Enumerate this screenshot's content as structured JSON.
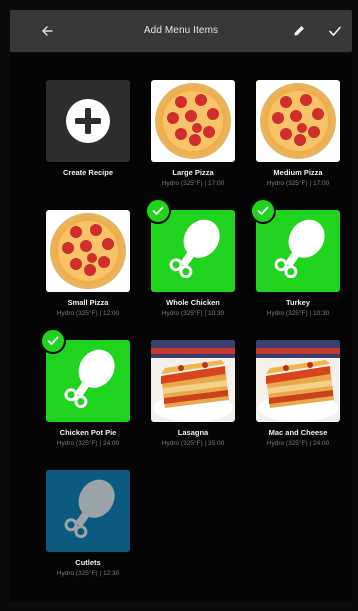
{
  "header": {
    "title": "Add Menu Items"
  },
  "icons": {
    "back": "arrow-left-icon",
    "edit": "pencil-icon",
    "confirm": "checkmark-icon",
    "add": "plus-icon",
    "selected": "check-badge-icon",
    "drumstick": "drumstick-icon"
  },
  "colors": {
    "selected_green": "#1fd31f",
    "blue_tile": "#0c5a7e",
    "topbar": "#383838",
    "background": "#0b0b0b"
  },
  "items": [
    {
      "name": "Create Recipe",
      "detail": ""
    },
    {
      "name": "Large Pizza",
      "detail": "Hydro (325°F) | 17:00",
      "image": "pizza",
      "selected": false
    },
    {
      "name": "Medium Pizza",
      "detail": "Hydro (325°F) | 17:00",
      "image": "pizza",
      "selected": false
    },
    {
      "name": "Small Pizza",
      "detail": "Hydro (325°F) | 12:00",
      "image": "pizza",
      "selected": false
    },
    {
      "name": "Whole Chicken",
      "detail": "Hydro (325°F) | 10:30",
      "image": "drumstick",
      "selected": true
    },
    {
      "name": "Turkey",
      "detail": "Hydro (325°F) | 10:30",
      "image": "drumstick",
      "selected": true
    },
    {
      "name": "Chicken Pot Pie",
      "detail": "Hydro (325°F) | 24:00",
      "image": "drumstick",
      "selected": true
    },
    {
      "name": "Lasagna",
      "detail": "Hydro (325°F) | 35:00",
      "image": "lasagna",
      "selected": false
    },
    {
      "name": "Mac and Cheese",
      "detail": "Hydro (325°F) | 24:00",
      "image": "lasagna",
      "selected": false
    },
    {
      "name": "Cutlets",
      "detail": "Hydro (325°F) | 12:30",
      "image": "drumstick",
      "selected": false
    }
  ]
}
